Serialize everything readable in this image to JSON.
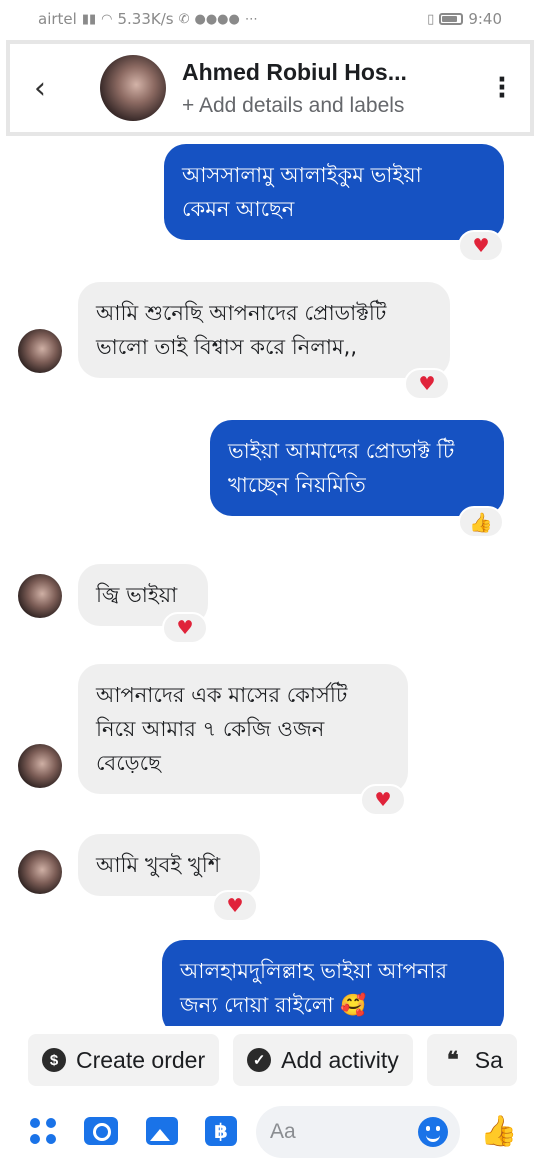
{
  "status_bar": {
    "carrier": "airtel",
    "network_speed": "5.33K/s",
    "time": "9:40"
  },
  "header": {
    "contact_name": "Ahmed Robiul Hos...",
    "subtitle": "+ Add details and labels"
  },
  "messages": [
    {
      "direction": "out",
      "lines": [
        "আসসালামু আলাইকুম ভাইয়া",
        "কেমন আছেন"
      ],
      "reaction": "heart"
    },
    {
      "direction": "in",
      "lines": [
        "আমি শুনেছি আপনাদের প্রোডাক্টটি",
        "ভালো তাই বিশ্বাস করে নিলাম,,"
      ],
      "reaction": "heart"
    },
    {
      "direction": "out",
      "lines": [
        "ভাইয়া আমাদের প্রোডাক্ট টি",
        "খাচ্ছেন নিয়মিতি"
      ],
      "reaction": "thumbs-up"
    },
    {
      "direction": "in",
      "lines": [
        "জ্বি ভাইয়া"
      ],
      "reaction": "heart"
    },
    {
      "direction": "in",
      "lines": [
        "আপনাদের এক মাসের কোর্সটি",
        "নিয়ে আমার ৭ কেজি ওজন",
        "বেড়েছে"
      ],
      "reaction": "heart"
    },
    {
      "direction": "in",
      "lines": [
        "আমি খুবই খুশি"
      ],
      "reaction": "heart"
    },
    {
      "direction": "out",
      "lines": [
        "আলহামদুলিল্লাহ ভাইয়া আপনার",
        "জন্য দোয়া রাইলো 🥰"
      ],
      "reaction": ""
    }
  ],
  "action_chips": {
    "create_order": "Create order",
    "add_activity": "Add activity",
    "save": "Sa"
  },
  "composer": {
    "placeholder": "Aa",
    "pay_glyph": "฿"
  },
  "colors": {
    "outgoing_bubble": "#1652c2",
    "incoming_bubble": "#efefef",
    "accent": "#1a73e8",
    "heart": "#e0233a"
  }
}
